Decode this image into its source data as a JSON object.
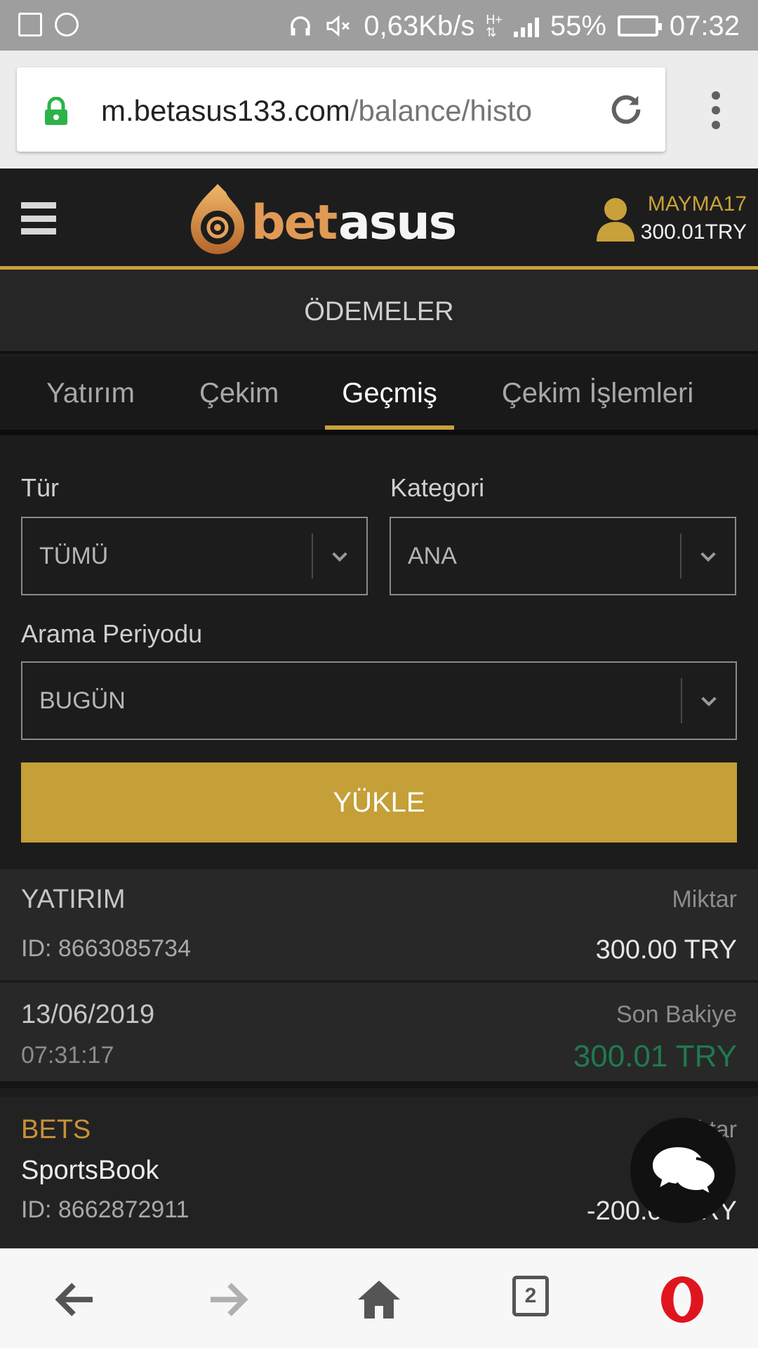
{
  "status_bar": {
    "network_speed": "0,63Kb/s",
    "battery": "55%",
    "time": "07:32"
  },
  "browser": {
    "url_domain": "m.betasus133.com",
    "url_path": "/balance/histo"
  },
  "header": {
    "logo_text": "betasus",
    "username": "MAYMA17",
    "balance": "300.01TRY"
  },
  "page_title": "ÖDEMELER",
  "tabs": [
    {
      "label": "Yatırım",
      "active": false
    },
    {
      "label": "Çekim",
      "active": false
    },
    {
      "label": "Geçmiş",
      "active": true
    },
    {
      "label": "Çekim İşlemleri",
      "active": false
    }
  ],
  "filters": {
    "type_label": "Tür",
    "type_value": "TÜMÜ",
    "category_label": "Kategori",
    "category_value": "ANA",
    "period_label": "Arama Periyodu",
    "period_value": "BUGÜN",
    "load_button": "YÜKLE"
  },
  "transactions": [
    {
      "type": "YATIRIM",
      "amount_label": "Miktar",
      "id": "ID: 8663085734",
      "amount": "300.00 TRY",
      "date": "13/06/2019",
      "time": "07:31:17",
      "balance_label": "Son Bakiye",
      "balance": "300.01 TRY"
    },
    {
      "type": "BETS",
      "subtype": "SportsBook",
      "amount_label": "Miktar",
      "id": "ID: 8662872911",
      "amount": "-200.00 TRY"
    }
  ],
  "bottom_nav": {
    "tab_count": "2"
  },
  "colors": {
    "accent": "#c9a13a",
    "button": "#c59f37",
    "balance_green": "#1f7a4e",
    "opera_red": "#e0141e"
  }
}
